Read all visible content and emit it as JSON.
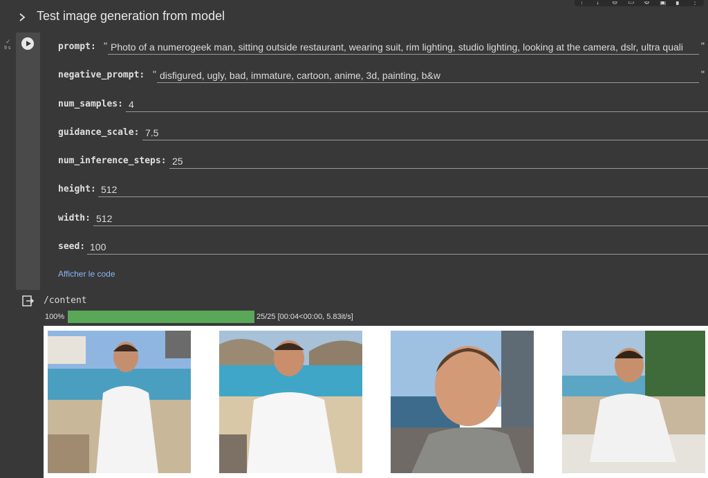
{
  "toolbar": {
    "icons": [
      "move-up-icon",
      "move-down-icon",
      "link-icon",
      "comment-icon",
      "gear-icon",
      "mirror-cell-icon",
      "delete-icon",
      "more-icon"
    ]
  },
  "section": {
    "title": "Test image generation from model"
  },
  "cell": {
    "status": "✓",
    "exec_time": "9 s",
    "fields": {
      "prompt": {
        "label": "prompt:",
        "value": "Photo of a numerogeek man, sitting outside restaurant, wearing suit, rim lighting, studio lighting, looking at the camera, dslr, ultra quali"
      },
      "negative_prompt": {
        "label": "negative_prompt:",
        "value": "disfigured, ugly, bad, immature, cartoon, anime, 3d, painting, b&w"
      },
      "num_samples": {
        "label": "num_samples:",
        "value": "4"
      },
      "guidance_scale": {
        "label": "guidance_scale:",
        "value": "7.5"
      },
      "num_inference_steps": {
        "label": "num_inference_steps:",
        "value": "25"
      },
      "height": {
        "label": "height:",
        "value": "512"
      },
      "width": {
        "label": "width:",
        "value": "512"
      },
      "seed": {
        "label": "seed:",
        "value": "100"
      }
    },
    "quote_char": "\"",
    "show_code": "Afficher le code"
  },
  "output": {
    "path": "/content",
    "progress_pct_text": "100%",
    "progress_fraction": 1.0,
    "progress_stats": "25/25 [00:04<00:00, 5.83it/s]",
    "images": [
      "generated-image-1",
      "generated-image-2",
      "generated-image-3",
      "generated-image-4"
    ]
  },
  "colors": {
    "background": "#383838",
    "progress": "#58a858",
    "link": "#8ab4f8"
  }
}
